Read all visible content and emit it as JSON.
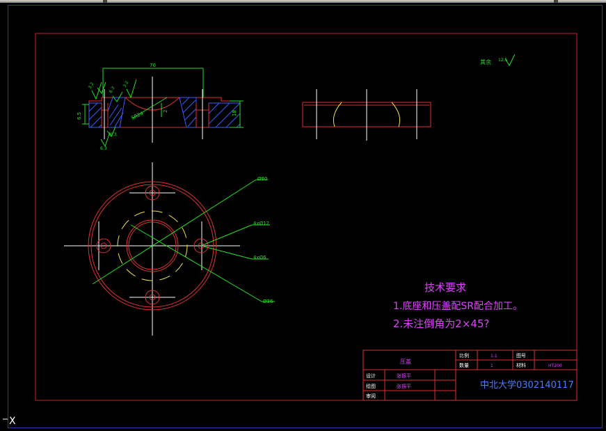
{
  "colors": {
    "background": "#000000",
    "frame": "#d02020",
    "outline": "#e03030",
    "dimension": "#22e022",
    "center_line": "#ffffff",
    "hatch": "#3b5bff",
    "arc_yellow": "#f2e24a",
    "text_magenta": "#e040ff",
    "text_blue": "#4a7cff"
  },
  "dims": {
    "width_70": "70",
    "height_18": "18",
    "height_6_5": "6.5",
    "sr24": "SR24",
    "depth_2": "2",
    "d90": "Ø90",
    "holes_4x12": "4xØ12",
    "holes_4x6": "4xØ6",
    "d36": "Ø36"
  },
  "roughness": {
    "other_label": "其余",
    "other_value": "12.5",
    "marks": [
      "3.2",
      "6.3",
      "3.2",
      "6.3",
      "6.3"
    ]
  },
  "notes": {
    "title": "技术要求",
    "line1": "1.底座和压盖配SR配合加工。",
    "line2": "2.未注倒角为2×45?"
  },
  "title_block": {
    "part_name": "压盖",
    "scale_label": "比例",
    "scale_value": "1:1",
    "drawing_no_label": "图号",
    "qty_label": "数量",
    "qty_value": "1",
    "material_label": "材料",
    "material_value": "HT200",
    "designer_label": "设计",
    "designer_name": "张振平",
    "drafter_label": "绘图",
    "drafter_name": "张振平",
    "reviewer_label": "审阅",
    "school_id": "中北大学0302140117"
  },
  "ucs_label": "X"
}
